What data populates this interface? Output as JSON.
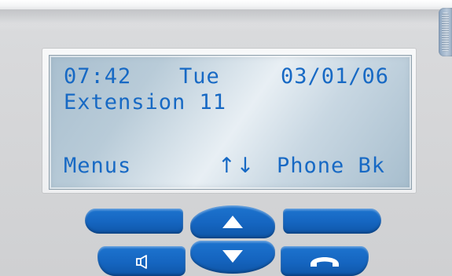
{
  "display": {
    "time": "07:42",
    "day": "Tue",
    "date": "03/01/06",
    "extension": "Extension 11",
    "softkeys": {
      "left": "Menus",
      "center": "↑↓",
      "right": "Phone Bk"
    }
  },
  "keypad": {
    "icons": {
      "nav_up": "up-arrow-icon",
      "nav_down": "down-arrow-icon",
      "speaker": "speaker-icon",
      "hangup": "handset-icon"
    }
  },
  "colors": {
    "lcd_text": "#1769c4",
    "key_blue": "#1565c0",
    "lcd_background": "#b8cbd8"
  }
}
